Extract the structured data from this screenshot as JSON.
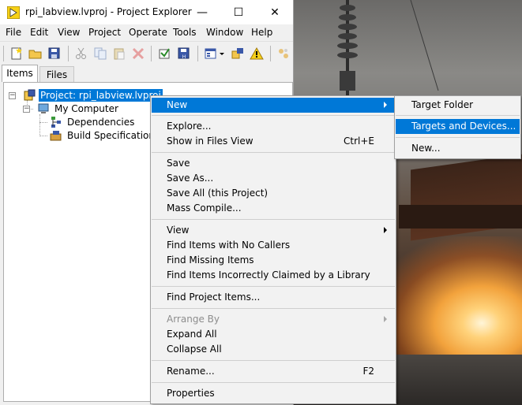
{
  "window": {
    "title": "rpi_labview.lvproj - Project Explorer",
    "controls": {
      "minimize": "—",
      "maximize": "☐",
      "close": "✕"
    }
  },
  "menubar": [
    "File",
    "Edit",
    "View",
    "Project",
    "Operate",
    "Tools",
    "Window",
    "Help"
  ],
  "toolbar": {
    "icons": [
      "new-vi-icon",
      "open-icon",
      "save-all-icon",
      "cut-icon",
      "copy-icon",
      "paste-icon",
      "delete-icon",
      "build-icon",
      "deploy-icon",
      "view-options-icon",
      "project-settings-icon",
      "warning-icon",
      "dependencies-icon"
    ]
  },
  "tabs": [
    {
      "label": "Items",
      "active": true
    },
    {
      "label": "Files",
      "active": false
    }
  ],
  "tree": {
    "project": "Project: rpi_labview.lvproj",
    "computer": "My Computer",
    "dependencies": "Dependencies",
    "build": "Build Specifications"
  },
  "context_menu": {
    "new": "New",
    "explore": "Explore...",
    "show_files": "Show in Files View",
    "show_files_shortcut": "Ctrl+E",
    "save": "Save",
    "save_as": "Save As...",
    "save_all": "Save All (this Project)",
    "mass_compile": "Mass Compile...",
    "view": "View",
    "find_no_callers": "Find Items with No Callers",
    "find_missing": "Find Missing Items",
    "find_incorrect": "Find Items Incorrectly Claimed by a Library",
    "find_project_items": "Find Project Items...",
    "arrange_by": "Arrange By",
    "expand_all": "Expand All",
    "collapse_all": "Collapse All",
    "rename": "Rename...",
    "rename_shortcut": "F2",
    "properties": "Properties"
  },
  "submenu": {
    "target_folder": "Target Folder",
    "targets_devices": "Targets and Devices...",
    "new": "New..."
  },
  "colors": {
    "highlight": "#0078d7",
    "menu_bg": "#f2f2f2",
    "window_bg": "#f0f0f0"
  }
}
